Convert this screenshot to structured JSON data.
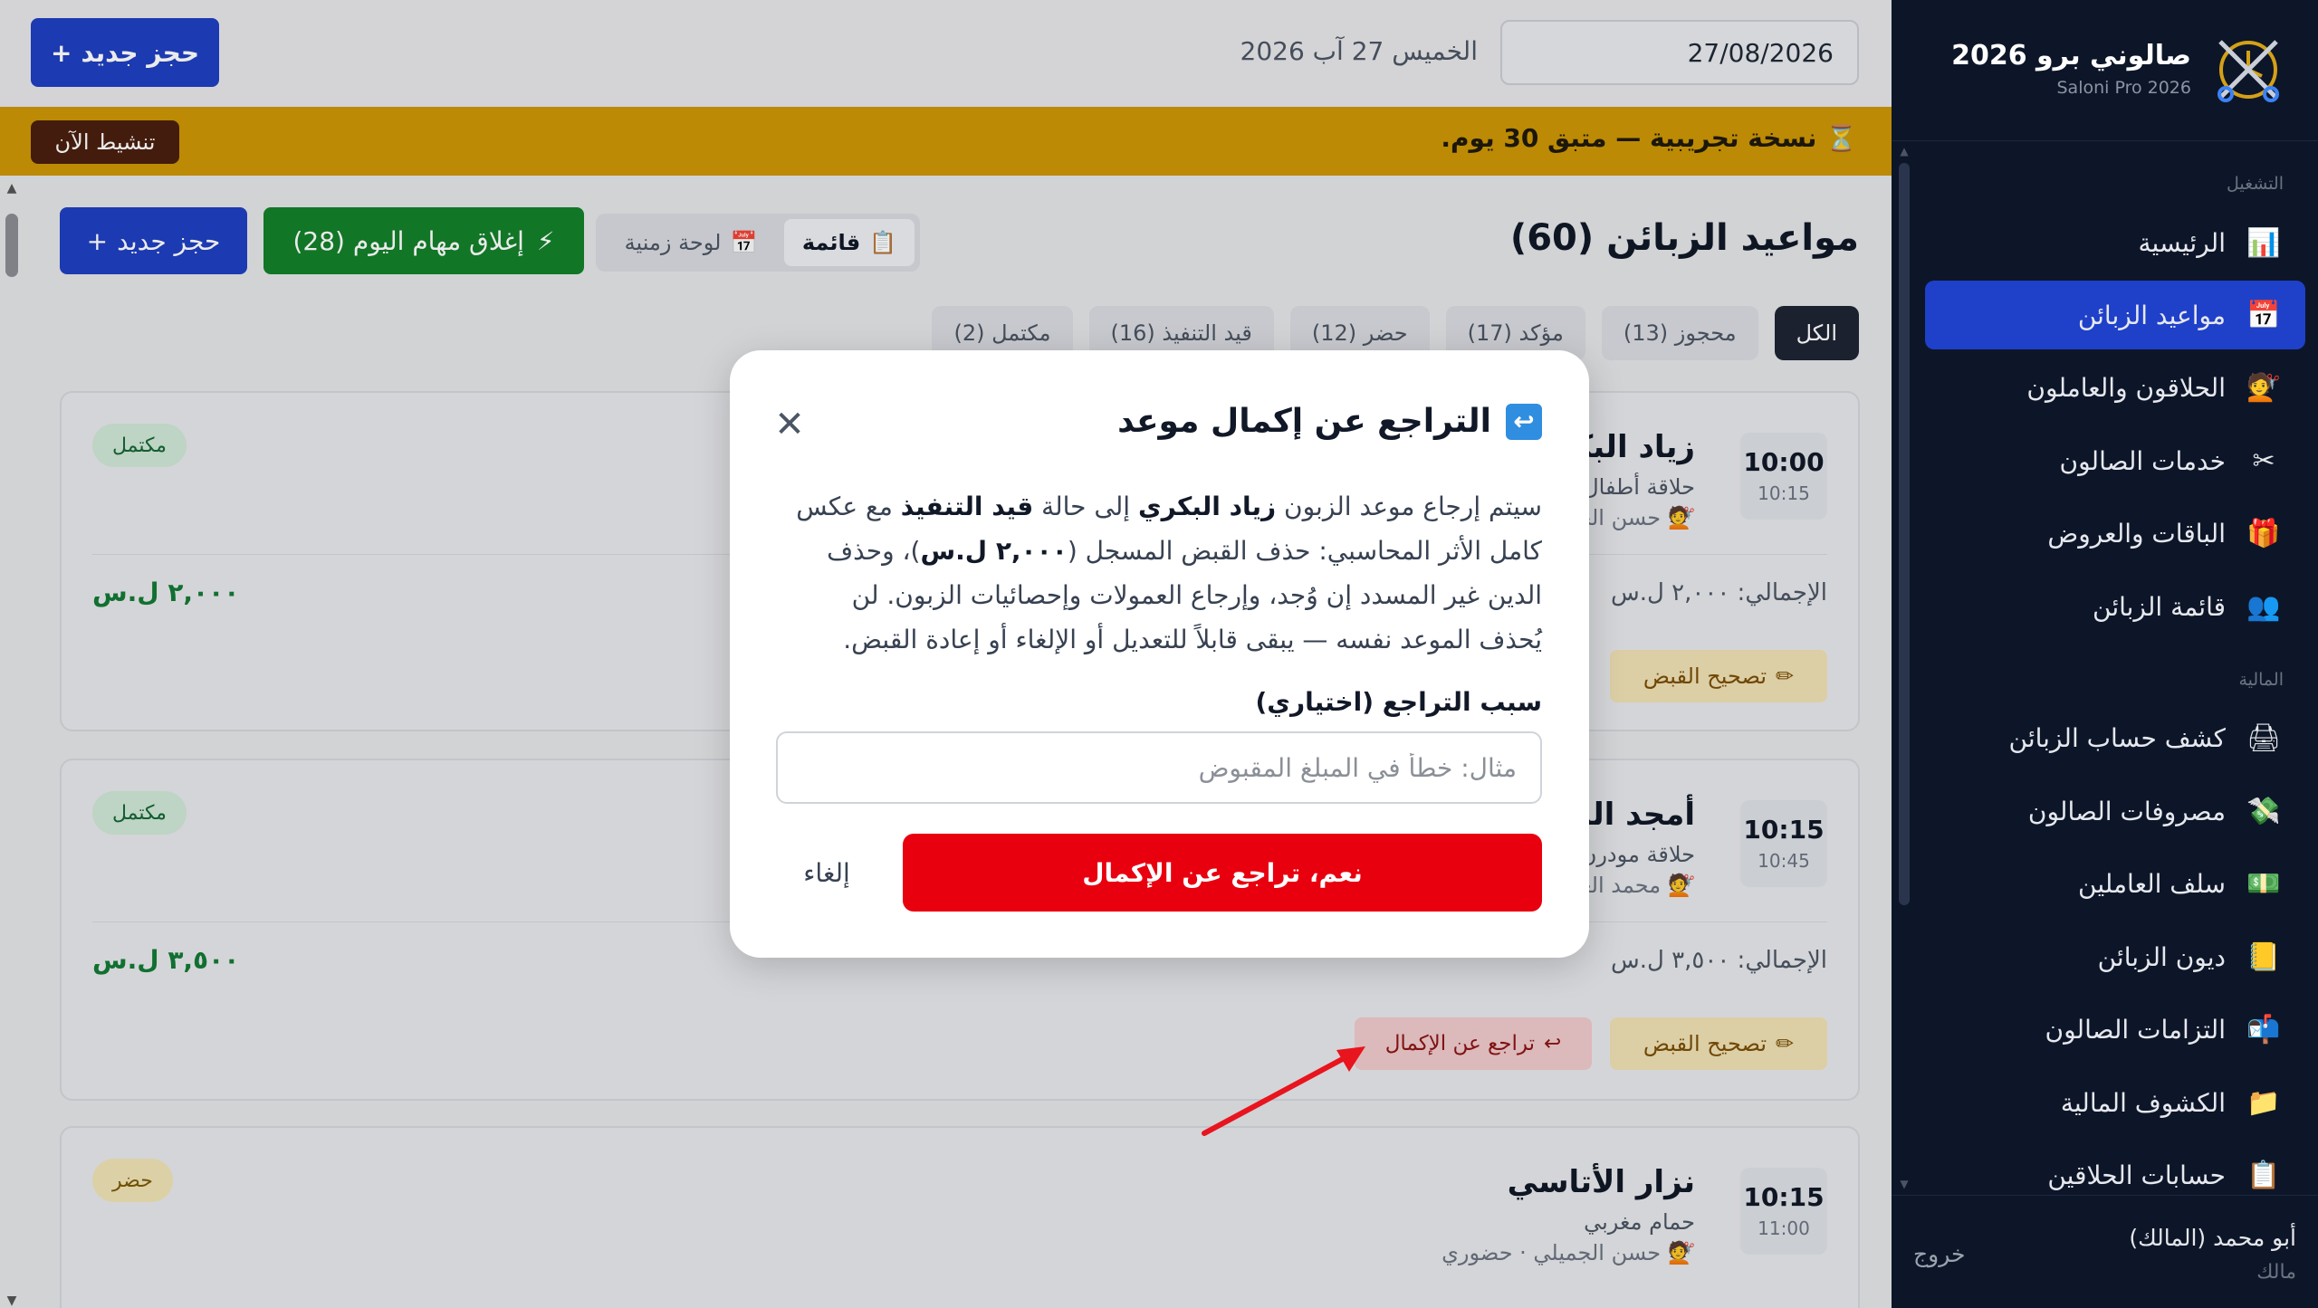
{
  "sidebar": {
    "brand_title": "صالوني برو 2026",
    "brand_subtitle": "Saloni Pro 2026",
    "section_operations": "التشغيل",
    "section_finance": "المالية",
    "items": [
      {
        "label": "الرئيسية",
        "icon": "chart-icon",
        "glyph": "📊"
      },
      {
        "label": "مواعيد الزبائن",
        "icon": "calendar-icon",
        "glyph": "📅"
      },
      {
        "label": "الحلاقون والعاملون",
        "icon": "barber-icon",
        "glyph": "💇"
      },
      {
        "label": "خدمات الصالون",
        "icon": "scissors-icon",
        "glyph": "✂"
      },
      {
        "label": "الباقات والعروض",
        "icon": "gift-icon",
        "glyph": "🎁"
      },
      {
        "label": "قائمة الزبائن",
        "icon": "users-icon",
        "glyph": "👥"
      },
      {
        "label": "كشف حساب الزبائن",
        "icon": "statement-icon",
        "glyph": "🖨"
      },
      {
        "label": "مصروفات الصالون",
        "icon": "money-wings-icon",
        "glyph": "💸"
      },
      {
        "label": "سلف العاملين",
        "icon": "cash-icon",
        "glyph": "💵"
      },
      {
        "label": "ديون الزبائن",
        "icon": "ledger-icon",
        "glyph": "📒"
      },
      {
        "label": "التزامات الصالون",
        "icon": "mailbox-icon",
        "glyph": "📬"
      },
      {
        "label": "الكشوف المالية",
        "icon": "folder-icon",
        "glyph": "📁"
      },
      {
        "label": "حسابات الحلاقين",
        "icon": "clipboard-icon",
        "glyph": "📋"
      }
    ],
    "user_name": "أبو محمد (المالك)",
    "user_role": "مالك",
    "logout": "خروج"
  },
  "topbar": {
    "date_value": "27/08/2026",
    "date_text": "الخميس 27 آب 2026",
    "new_booking": "حجز جديد",
    "plus": "+"
  },
  "trial": {
    "text": "نسخة تجريبية — متبق 30 يوم.",
    "activate": "تنشيط الآن"
  },
  "page": {
    "title": "مواعيد الزبائن (60)",
    "view_list": "قائمة",
    "view_timeline": "لوحة زمنية",
    "close_day": "إغلاق مهام اليوم (28)",
    "new_booking": "حجز جديد",
    "filters": [
      "الكل",
      "محجوز (13)",
      "مؤكد (17)",
      "حضر (12)",
      "قيد التنفيذ (16)",
      "مكتمل (2)"
    ]
  },
  "cards": [
    {
      "time": "10:00",
      "end": "10:15",
      "client": "زياد البكري",
      "service": "حلاقة أطفال",
      "barber": "حسن الجميلي",
      "status": "مكتمل",
      "total_label": "الإجمالي: ٢,٠٠٠ ل.س",
      "total_amount": "٢,٠٠٠ ل.س",
      "fix": "تصحيح القبض"
    },
    {
      "time": "10:15",
      "end": "10:45",
      "client": "أمجد الشامي",
      "service": "حلاقة مودرن",
      "barber": "محمد العلي",
      "status": "مكتمل",
      "total_label": "الإجمالي: ٣,٥٠٠ ل.س",
      "total_amount": "٣,٥٠٠ ل.س",
      "fix": "تصحيح القبض",
      "revert": "تراجع عن الإكمال"
    },
    {
      "time": "10:15",
      "end": "11:00",
      "client": "نزار الأتاسي",
      "service": "حمام مغربي",
      "barber": "حسن الجميلي · حضوري",
      "status": "حضر"
    }
  ],
  "modal": {
    "title": "التراجع عن إكمال موعد",
    "body_1": "سيتم إرجاع موعد الزبون ",
    "body_client": "زياد البكري",
    "body_2": " إلى حالة ",
    "body_state": "قيد التنفيذ",
    "body_3": " مع عكس كامل الأثر المحاسبي: حذف القبض المسجل (",
    "body_amount": "٢,٠٠٠ ل.س",
    "body_4": ")، وحذف الدين غير المسدد إن وُجد، وإرجاع العمولات وإحصائيات الزبون. لن يُحذف الموعد نفسه — يبقى قابلاً للتعديل أو الإلغاء أو إعادة القبض.",
    "reason_label": "سبب التراجع (اختياري)",
    "reason_placeholder": "مثال: خطأ في المبلغ المقبوض",
    "confirm": "نعم، تراجع عن الإكمال",
    "cancel": "إلغاء"
  },
  "colors": {
    "sidebar_bg": "#0d1628",
    "accent_blue": "#1f3fc0",
    "trial_yellow": "#cc9605",
    "confirm_red": "#e8000f",
    "success_green": "#13812a"
  }
}
